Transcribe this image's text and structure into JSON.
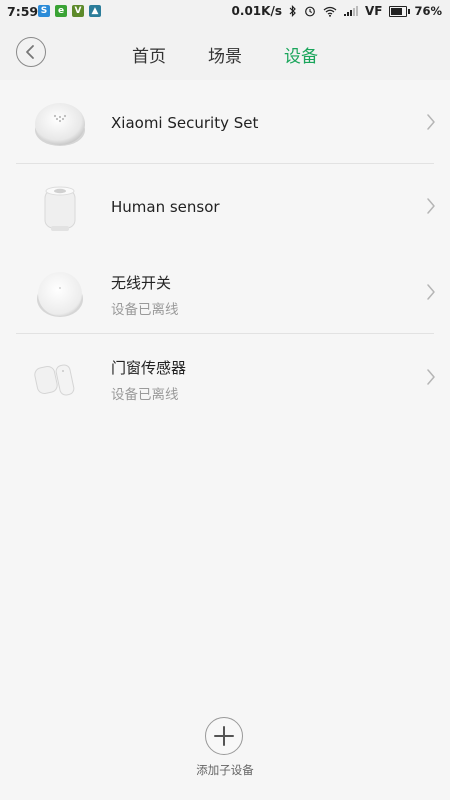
{
  "status_bar": {
    "time": "7:59",
    "net_speed": "0.01K/s",
    "carrier": "VF",
    "battery": "76%",
    "battery_level": 0.76
  },
  "header": {
    "tabs": [
      {
        "label": "首页",
        "active": false
      },
      {
        "label": "场景",
        "active": false
      },
      {
        "label": "设备",
        "active": true
      }
    ],
    "accent_color": "#1aa55b"
  },
  "devices": [
    {
      "name": "Xiaomi Security Set",
      "status": "",
      "icon": "gateway-icon"
    },
    {
      "name": "Human sensor",
      "status": "",
      "icon": "motion-sensor-icon"
    },
    {
      "name": "无线开关",
      "status": "设备已离线",
      "icon": "wireless-switch-icon"
    },
    {
      "name": "门窗传感器",
      "status": "设备已离线",
      "icon": "door-window-sensor-icon"
    }
  ],
  "add_button": {
    "label": "添加子设备"
  }
}
